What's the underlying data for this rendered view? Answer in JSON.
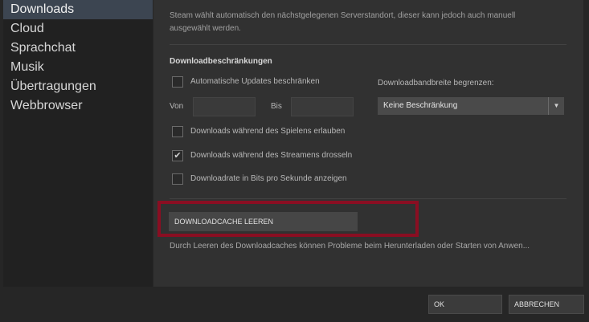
{
  "sidebar": {
    "items": [
      {
        "label": "Downloads",
        "active": true
      },
      {
        "label": "Cloud"
      },
      {
        "label": "Sprachchat"
      },
      {
        "label": "Musik"
      },
      {
        "label": "Übertragungen"
      },
      {
        "label": "Webbrowser"
      }
    ]
  },
  "main": {
    "server_desc_line1": "Steam wählt automatisch den nächstgelegenen Serverstandort, dieser kann jedoch auch manuell",
    "server_desc_line2": "ausgewählt werden.",
    "restrictions_title": "Downloadbeschränkungen",
    "auto_updates_label": "Automatische Updates beschränken",
    "bandwidth_label": "Downloadbandbreite begrenzen:",
    "from_label": "Von",
    "to_label": "Bis",
    "from_value": "",
    "to_value": "",
    "bandwidth_value": "Keine Beschränkung",
    "allow_while_playing_label": "Downloads während des Spielens erlauben",
    "throttle_streaming_label": "Downloads während des Streamens drosseln",
    "bits_per_second_label": "Downloadrate in Bits pro Sekunde anzeigen",
    "clear_cache_label": "DOWNLOADCACHE LEEREN",
    "clear_cache_info": "Durch Leeren des Downloadcaches können Probleme beim Herunterladen oder Starten von Anwen..."
  },
  "checkboxes": {
    "auto_updates": false,
    "allow_while_playing": false,
    "throttle_streaming": true,
    "bits_per_second": false
  },
  "footer": {
    "ok_label": "OK",
    "cancel_label": "ABBRECHEN"
  },
  "colors": {
    "highlight_border": "#8a0e22",
    "active_item_bg": "#3c4551"
  }
}
